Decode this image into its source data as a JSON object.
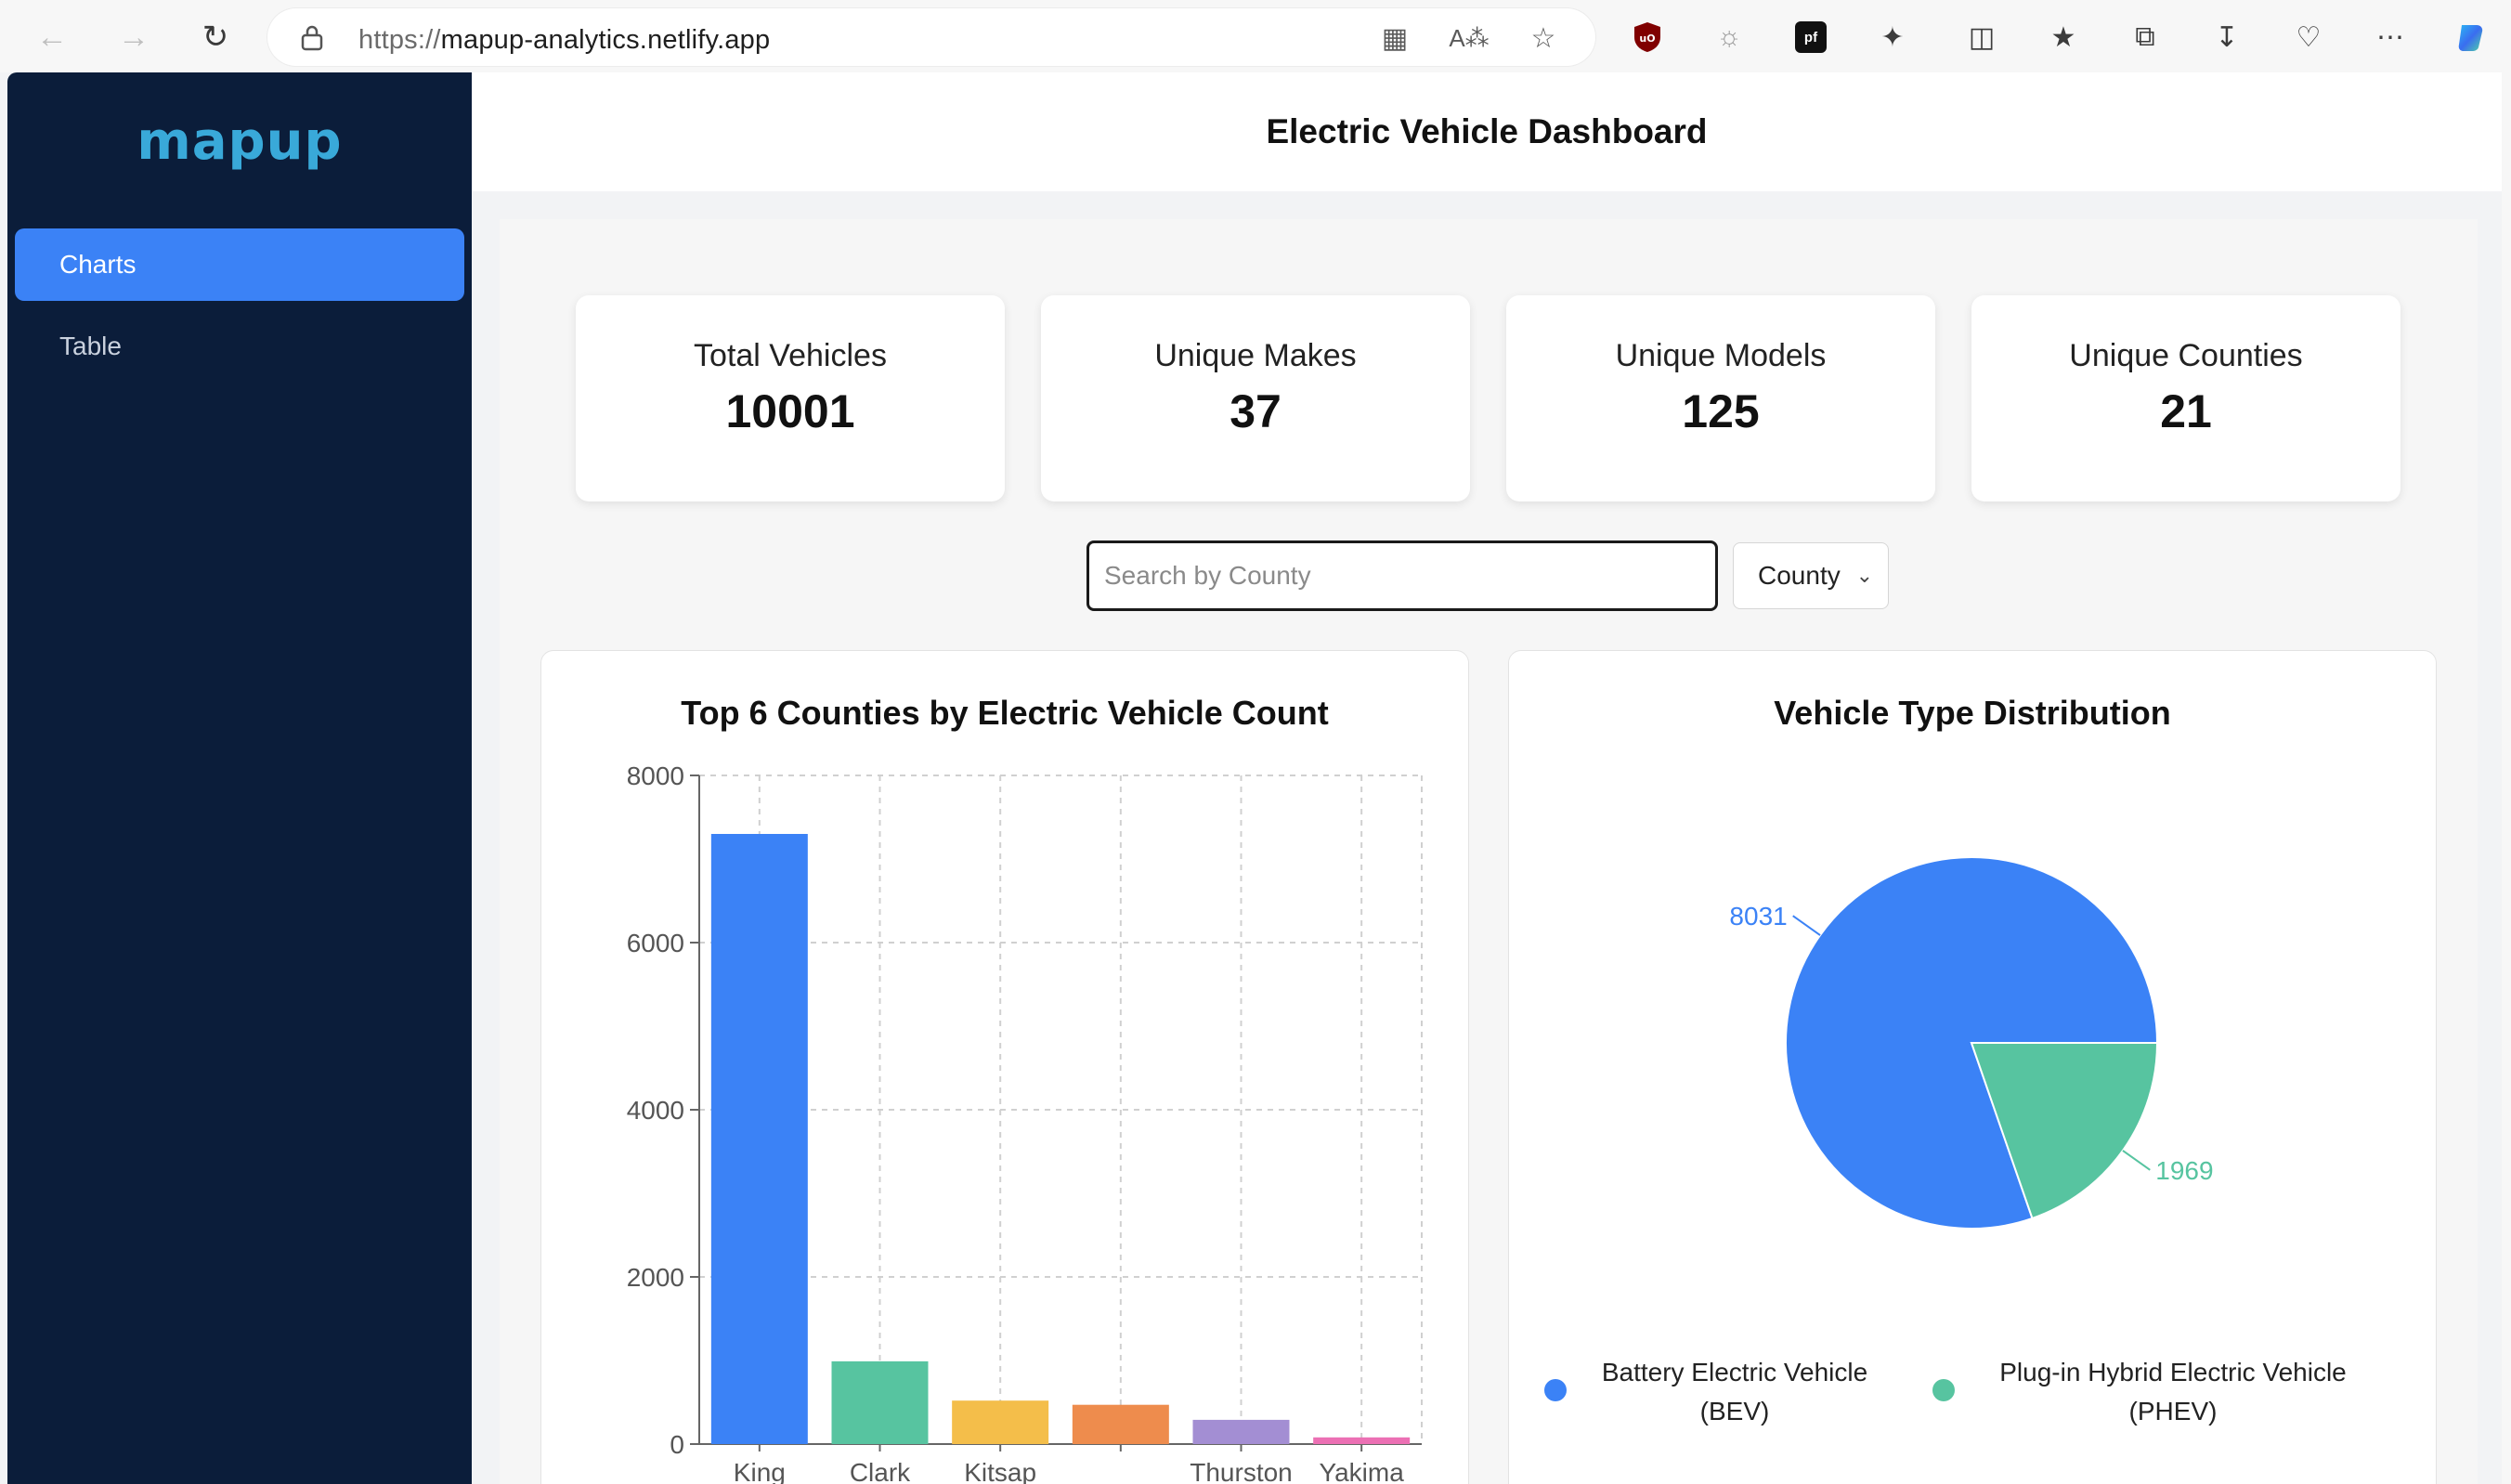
{
  "browser": {
    "url_protocol": "https://",
    "url_host": "mapup-analytics.netlify.app"
  },
  "sidebar": {
    "logo": "mapup",
    "items": [
      {
        "label": "Charts",
        "active": true
      },
      {
        "label": "Table",
        "active": false
      }
    ]
  },
  "header": {
    "title": "Electric Vehicle Dashboard"
  },
  "stats": [
    {
      "label": "Total Vehicles",
      "value": "10001"
    },
    {
      "label": "Unique Makes",
      "value": "37"
    },
    {
      "label": "Unique Models",
      "value": "125"
    },
    {
      "label": "Unique Counties",
      "value": "21"
    }
  ],
  "filters": {
    "search_placeholder": "Search by County",
    "select_value": "County"
  },
  "colors": {
    "accent": "#3b82f6",
    "sidebar_bg": "#0b1d3a",
    "logo": "#39a9d9"
  },
  "chart_data": [
    {
      "type": "bar",
      "title": "Top 6 Counties by Electric Vehicle Count",
      "categories": [
        "King",
        "Clark",
        "Kitsap",
        "",
        "Thurston",
        "Yakima"
      ],
      "values": [
        7300,
        990,
        520,
        470,
        290,
        80
      ],
      "colors": [
        "#3b82f6",
        "#57c4a0",
        "#f4be4a",
        "#ee8c4d",
        "#a38ed3",
        "#ec70b4"
      ],
      "yticks": [
        0,
        2000,
        4000,
        6000,
        8000
      ],
      "ylim": [
        0,
        8000
      ],
      "grid": true
    },
    {
      "type": "pie",
      "title": "Vehicle Type Distribution",
      "slices": [
        {
          "label": "Battery Electric Vehicle (BEV)",
          "legend_lines": [
            "Battery Electric Vehicle",
            "(BEV)"
          ],
          "value": 8031,
          "color": "#3b82f6"
        },
        {
          "label": "Plug-in Hybrid Electric Vehicle (PHEV)",
          "legend_lines": [
            "Plug-in Hybrid Electric Vehicle",
            "(PHEV)"
          ],
          "value": 1969,
          "color": "#57c4a0"
        }
      ],
      "legend_position": "bottom"
    }
  ]
}
